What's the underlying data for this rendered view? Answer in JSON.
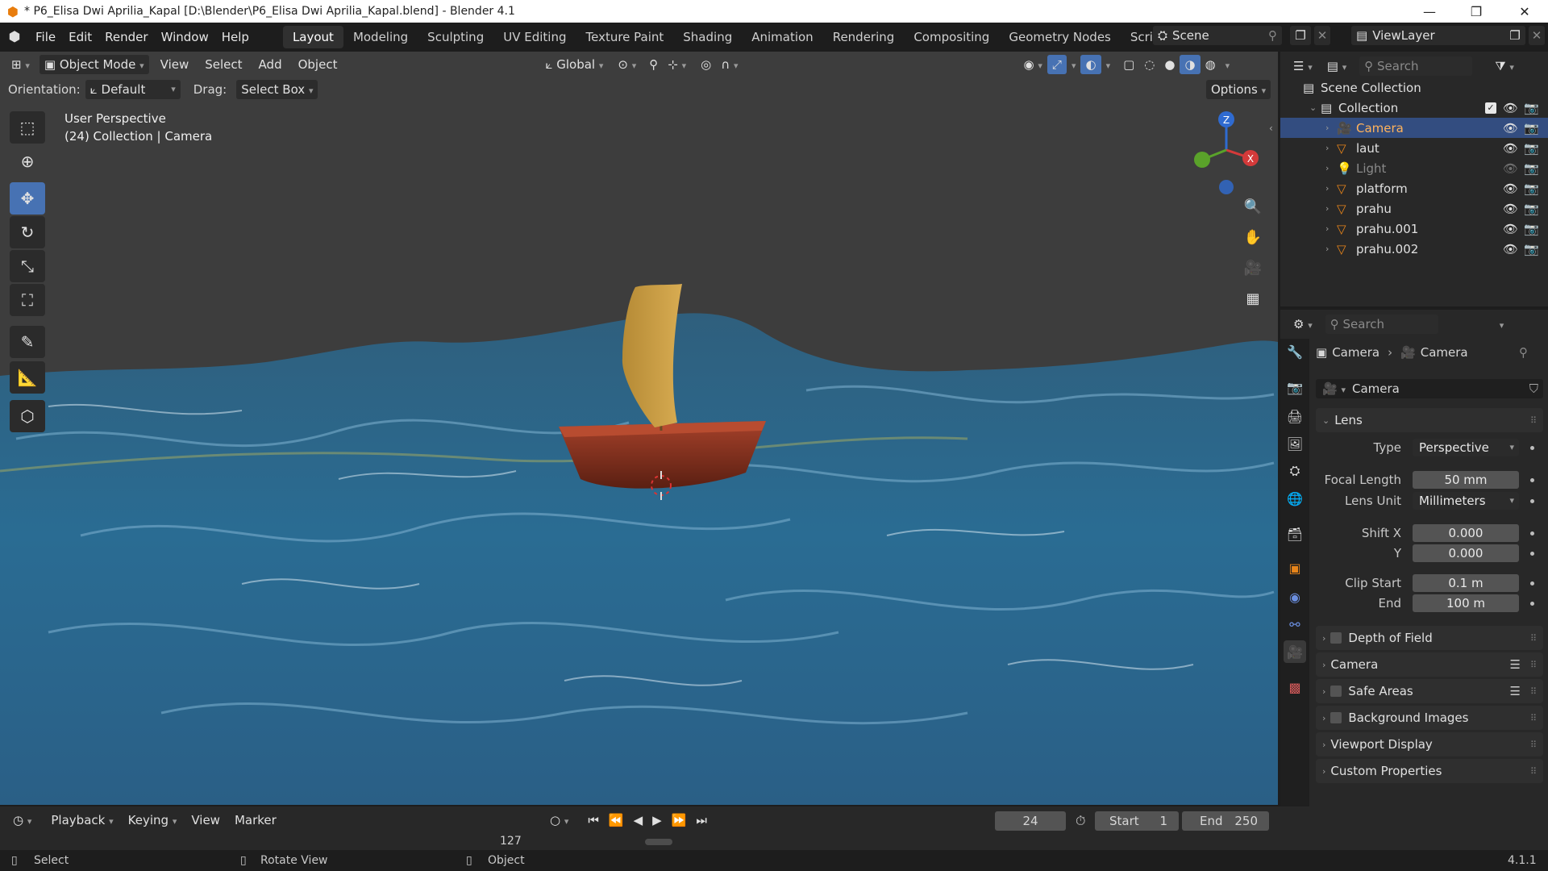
{
  "window": {
    "title": "* P6_Elisa Dwi Aprilia_Kapal [D:\\Blender\\P6_Elisa Dwi Aprilia_Kapal.blend] - Blender 4.1",
    "controls": [
      "—",
      "❐",
      "✕"
    ]
  },
  "menu": [
    "File",
    "Edit",
    "Render",
    "Window",
    "Help"
  ],
  "workspaces": [
    "Layout",
    "Modeling",
    "Sculpting",
    "UV Editing",
    "Texture Paint",
    "Shading",
    "Animation",
    "Rendering",
    "Compositing",
    "Geometry Nodes",
    "Scripting"
  ],
  "active_workspace": "Layout",
  "scene": {
    "name": "Scene",
    "view_layer": "ViewLayer"
  },
  "viewport": {
    "mode": "Object Mode",
    "menus": [
      "View",
      "Select",
      "Add",
      "Object"
    ],
    "transform_orientation": "Global",
    "orientation_label": "Orientation:",
    "orientation_value": "Default",
    "drag_label": "Drag:",
    "drag_value": "Select Box",
    "options_label": "Options",
    "overlay_line1": "User Perspective",
    "overlay_line2": "(24) Collection | Camera",
    "gizmo_axes": {
      "z": "Z",
      "x": "X"
    }
  },
  "outliner": {
    "search_placeholder": "Search",
    "root": "Scene Collection",
    "collection": "Collection",
    "objects": [
      {
        "name": "Camera",
        "selected": true,
        "dimmed": false
      },
      {
        "name": "laut",
        "selected": false,
        "dimmed": false
      },
      {
        "name": "Light",
        "selected": false,
        "dimmed": true
      },
      {
        "name": "platform",
        "selected": false,
        "dimmed": false
      },
      {
        "name": "prahu",
        "selected": false,
        "dimmed": false
      },
      {
        "name": "prahu.001",
        "selected": false,
        "dimmed": false
      },
      {
        "name": "prahu.002",
        "selected": false,
        "dimmed": false
      }
    ]
  },
  "properties": {
    "search_placeholder": "Search",
    "breadcrumb_object": "Camera",
    "breadcrumb_data": "Camera",
    "datablock": "Camera",
    "lens_panel": "Lens",
    "type_label": "Type",
    "type_value": "Perspective",
    "focal_label": "Focal Length",
    "focal_value": "50 mm",
    "lens_unit_label": "Lens Unit",
    "lens_unit_value": "Millimeters",
    "shift_x_label": "Shift X",
    "shift_x_value": "0.000",
    "shift_y_label": "Y",
    "shift_y_value": "0.000",
    "clip_start_label": "Clip Start",
    "clip_start_value": "0.1 m",
    "clip_end_label": "End",
    "clip_end_value": "100 m",
    "collapsed_panels": [
      "Depth of Field",
      "Camera",
      "Safe Areas",
      "Background Images",
      "Viewport Display",
      "Custom Properties"
    ]
  },
  "timeline": {
    "menus": [
      "Playback",
      "Keying",
      "View",
      "Marker"
    ],
    "current_frame": "24",
    "start_label": "Start",
    "start_value": "1",
    "end_label": "End",
    "end_value": "250",
    "ruler_frame": "127"
  },
  "statusbar": {
    "items": [
      "Select",
      "Rotate View",
      "Object"
    ],
    "version": "4.1.1"
  },
  "colors": {
    "accent": "#4772b3",
    "selection": "#334d80",
    "sea": "#2d6a8c",
    "boat": "#8b2f1c",
    "sail": "#c9a046"
  }
}
